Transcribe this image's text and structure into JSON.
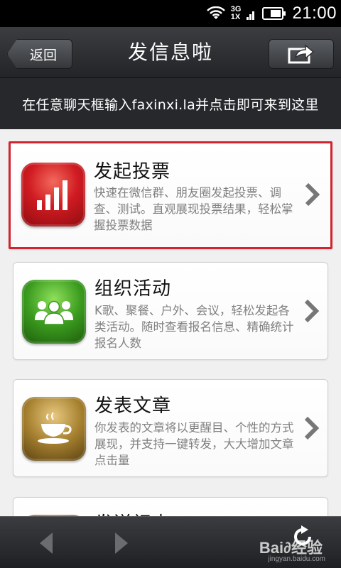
{
  "status_bar": {
    "network_top": "3G",
    "network_bottom": "1X",
    "time": "21:00"
  },
  "nav": {
    "back_label": "返回",
    "title": "发信息啦",
    "share_icon": "share-icon"
  },
  "hint": {
    "text": "在任意聊天框输入faxinxi.la并点击即可来到这里"
  },
  "cards": [
    {
      "title": "发起投票",
      "description": "快速在微信群、朋友圈发起投票、调查、测试。直观展现投票结果，轻松掌握投票数据",
      "icon": "bar-chart-icon",
      "icon_color": "#c7121c",
      "highlighted": true
    },
    {
      "title": "组织活动",
      "description": "K歌、聚餐、户外、会议，轻松发起各类活动。随时查看报名信息、精确统计报名人数",
      "icon": "people-icon",
      "icon_color": "#3a9a1e",
      "highlighted": false
    },
    {
      "title": "发表文章",
      "description": "你发表的文章将以更醒目、个性的方式展现，并支持一键转发，大大增加文章点击量",
      "icon": "coffee-cup-icon",
      "icon_color": "#8a6a26",
      "highlighted": false
    },
    {
      "title": "发送祝卡",
      "description": "",
      "icon": "card-icon",
      "icon_color": "#b5651d",
      "highlighted": false
    }
  ],
  "bottom_bar": {
    "watermark": "Bai∂经验",
    "watermark_sub": "jingyan.baidu.com"
  },
  "colors": {
    "highlight_border": "#d2232f",
    "nav_background": "#2e3033"
  }
}
